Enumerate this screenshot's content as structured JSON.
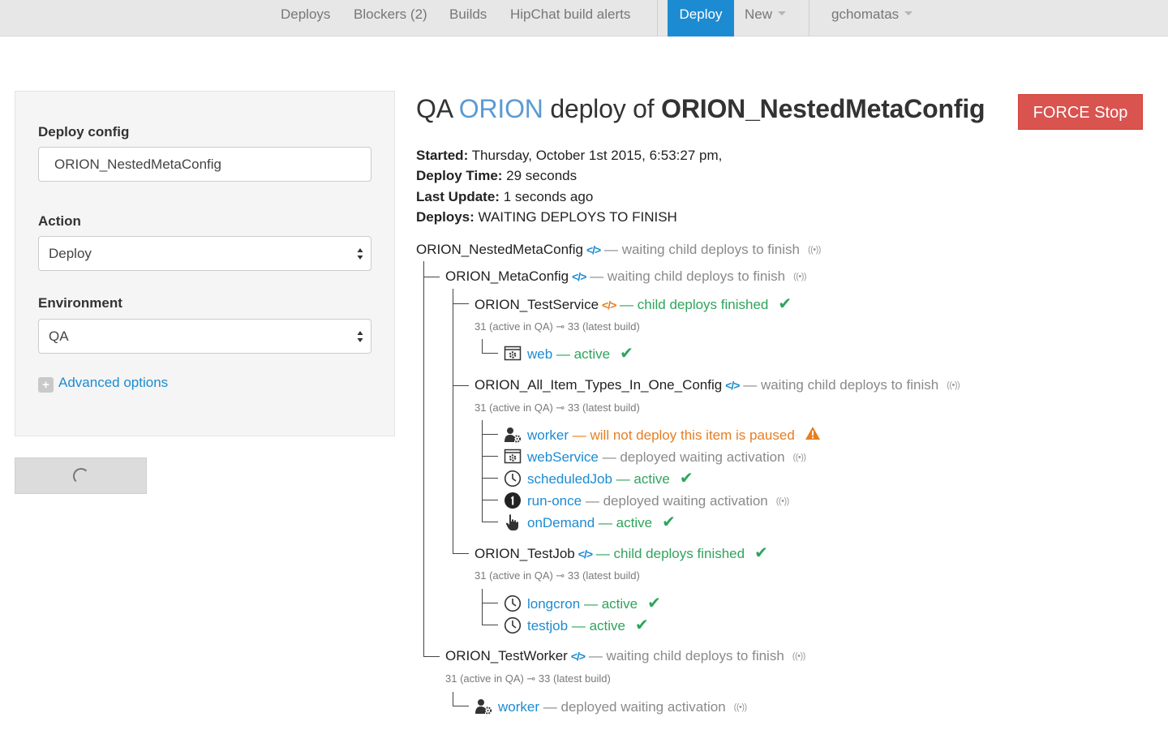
{
  "nav": {
    "links": [
      "Deploys",
      "Blockers (2)",
      "Builds",
      "HipChat build alerts"
    ],
    "active": "Deploy",
    "new_label": "New",
    "user": "gchomatas"
  },
  "sidebar": {
    "deploy_config_label": "Deploy config",
    "deploy_config_value": "ORION_NestedMetaConfig",
    "action_label": "Action",
    "action_value": "Deploy",
    "environment_label": "Environment",
    "environment_value": "QA",
    "advanced_label": "Advanced options"
  },
  "header": {
    "env": "QA",
    "app": "ORION",
    "deploy_of": "deploy of",
    "config": "ORION_NestedMetaConfig",
    "force_stop": "FORCE Stop"
  },
  "info": {
    "started_label": "Started:",
    "started_value": "Thursday, October 1st 2015, 6:53:27 pm,",
    "deploy_time_label": "Deploy Time:",
    "deploy_time_value": "29 seconds",
    "last_update_label": "Last Update:",
    "last_update_value": "1 seconds ago",
    "deploys_label": "Deploys:",
    "deploys_value": "WAITING DEPLOYS TO FINISH"
  },
  "tree": {
    "code_glyph": "</>",
    "radio_glyph": "((•))",
    "dash": "—",
    "root": {
      "name": "ORION_NestedMetaConfig",
      "status": "waiting child deploys to finish"
    },
    "meta": {
      "name": "ORION_MetaConfig",
      "status": "waiting child deploys to finish"
    },
    "test_service": {
      "name": "ORION_TestService",
      "status": "child deploys finished",
      "builds": "31 (active in QA) ⊸ 33 (latest build)",
      "items": [
        {
          "name": "web",
          "status": "active",
          "icon": "web-service-icon"
        }
      ]
    },
    "all_items": {
      "name": "ORION_All_Item_Types_In_One_Config",
      "status": "waiting child deploys to finish",
      "builds": "31 (active in QA) ⊸ 33 (latest build)",
      "items": [
        {
          "name": "worker",
          "status": "will not deploy this item is paused",
          "icon": "worker-icon"
        },
        {
          "name": "webService",
          "status": "deployed waiting activation",
          "icon": "web-service-icon"
        },
        {
          "name": "scheduledJob",
          "status": "active",
          "icon": "clock-icon"
        },
        {
          "name": "run-once",
          "status": "deployed waiting activation",
          "icon": "run-once-icon"
        },
        {
          "name": "onDemand",
          "status": "active",
          "icon": "hand-pointer-icon"
        }
      ]
    },
    "test_job": {
      "name": "ORION_TestJob",
      "status": "child deploys finished",
      "builds": "31 (active in QA) ⊸ 33 (latest build)",
      "items": [
        {
          "name": "longcron",
          "status": "active",
          "icon": "clock-icon"
        },
        {
          "name": "testjob",
          "status": "active",
          "icon": "clock-icon"
        }
      ]
    },
    "test_worker": {
      "name": "ORION_TestWorker",
      "status": "waiting child deploys to finish",
      "builds": "31 (active in QA) ⊸ 33 (latest build)",
      "items": [
        {
          "name": "worker",
          "status": "deployed waiting activation",
          "icon": "worker-icon"
        }
      ]
    }
  }
}
